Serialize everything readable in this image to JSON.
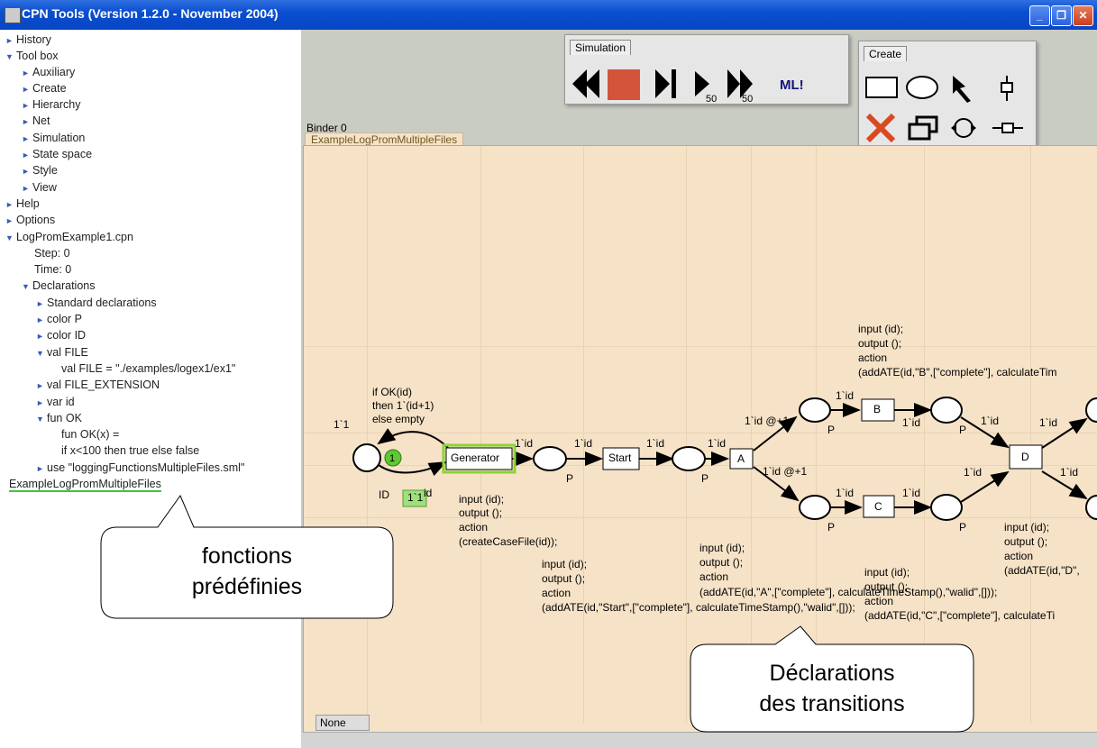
{
  "window": {
    "title": "CPN Tools (Version 1.2.0 - November 2004)"
  },
  "sidebar": {
    "history": "History",
    "toolbox": "Tool box",
    "auxiliary": "Auxiliary",
    "create": "Create",
    "hierarchy": "Hierarchy",
    "net": "Net",
    "simulation": "Simulation",
    "state_space": "State space",
    "style": "Style",
    "view": "View",
    "help": "Help",
    "options": "Options",
    "file": "LogPromExample1.cpn",
    "step": "Step: 0",
    "time": "Time: 0",
    "declarations": "Declarations",
    "standard_decl": "Standard declarations",
    "color_p": "color P",
    "color_id": "color ID",
    "val_file": "val FILE",
    "val_file_def": "val FILE = \"./examples/logex1/ex1\"",
    "val_file_ext": "val FILE_EXTENSION",
    "var_id": "var id",
    "fun_ok": "fun OK",
    "fun_ok_def1": "fun OK(x) =",
    "fun_ok_def2": "if x<100 then true else false",
    "use_file": "use \"loggingFunctionsMultipleFiles.sml\"",
    "page_link": "ExampleLogPromMultipleFiles"
  },
  "palettes": {
    "simulation": {
      "label": "Simulation",
      "step_a": "50",
      "step_b": "50",
      "ml": "ML!"
    },
    "create": {
      "label": "Create"
    }
  },
  "binder": {
    "label": "Binder 0",
    "tab": "ExampleLogPromMultipleFiles",
    "status_tab": "None"
  },
  "net": {
    "arc_guard_1": "if OK(id)",
    "arc_guard_2": "then 1`(id+1)",
    "arc_guard_3": "else empty",
    "init_mark": "1`1",
    "token_count": "1",
    "place_type_id": "ID",
    "marking_box": "1`1",
    "marking_id": "id",
    "generator": "Generator",
    "start": "Start",
    "t_a": "A",
    "t_b": "B",
    "t_c": "C",
    "t_d": "D",
    "p": "P",
    "arc_1id": "1`id",
    "arc_at": "1`id @+1",
    "gen_code": [
      "input (id);",
      "output ();",
      "action",
      "(createCaseFile(id));"
    ],
    "start_code": [
      "input (id);",
      "output ();",
      "action",
      "(addATE(id,\"Start\",[\"complete\"], calculateTimeStamp(),\"walid\",[]));"
    ],
    "a_code": [
      "input (id);",
      "output ();",
      "action",
      "(addATE(id,\"A\",[\"complete\"], calculateTimeStamp(),\"walid\",[]));"
    ],
    "b_code": [
      "input (id);",
      "output ();",
      "action",
      "(addATE(id,\"B\",[\"complete\"], calculateTim"
    ],
    "c_code": [
      "input (id);",
      "output ();",
      "action",
      "(addATE(id,\"C\",[\"complete\"], calculateTi"
    ],
    "d_code": [
      "input (id);",
      "output ();",
      "action",
      "(addATE(id,\"D\","
    ]
  },
  "callouts": {
    "left_1": "fonctions",
    "left_2": "prédéfinies",
    "right_1": "Déclarations",
    "right_2": "des transitions"
  }
}
